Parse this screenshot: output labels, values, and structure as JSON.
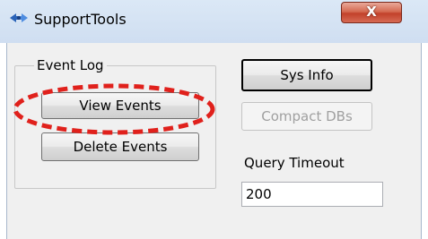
{
  "window": {
    "title": "SupportTools",
    "close_label": "X",
    "app_icon": "supporttools-app-icon"
  },
  "event_log": {
    "group_label": "Event Log",
    "view_events_label": "View Events",
    "delete_events_label": "Delete Events"
  },
  "tools": {
    "sys_info_label": "Sys Info",
    "compact_dbs_label": "Compact DBs",
    "compact_dbs_enabled": false
  },
  "query": {
    "label": "Query Timeout",
    "value": "200"
  },
  "annotation": {
    "type": "dashed-ellipse",
    "color": "#e0211c",
    "target": "view-events-button"
  },
  "colors": {
    "title_bar": "#cfdef1",
    "close_button": "#c2412a",
    "client_background": "#f0f0f0",
    "accent_strip": "#3a7fd4"
  }
}
